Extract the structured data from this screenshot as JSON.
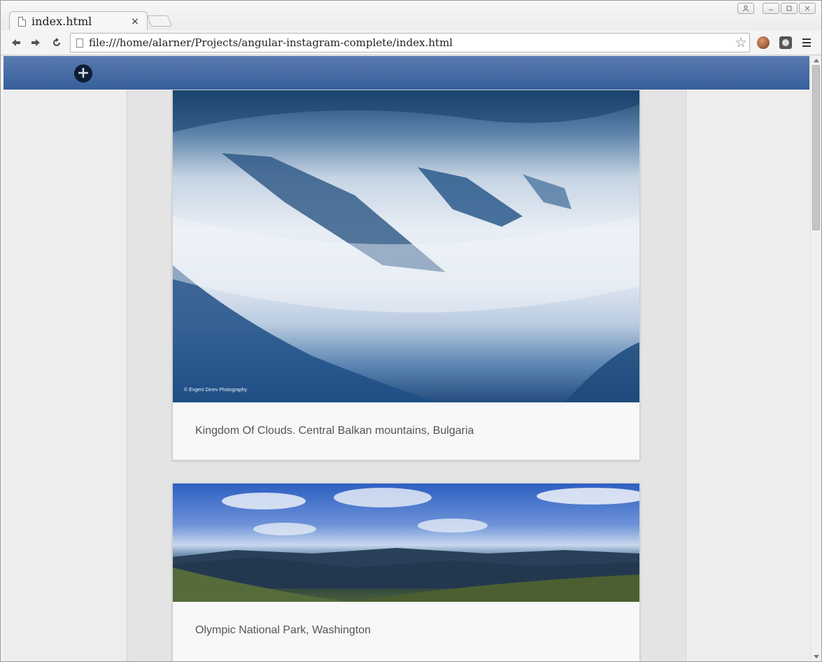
{
  "browser": {
    "tab": {
      "title": "index.html",
      "close_glyph": "×"
    },
    "address_bar": {
      "url": "file:///home/alarner/Projects/angular-instagram-complete/index.html"
    },
    "icons": [
      "page-icon",
      "star-icon",
      "back-icon",
      "forward-icon",
      "reload-icon",
      "menu-icon",
      "user-icon",
      "minimize-icon",
      "maximize-icon",
      "close-icon"
    ]
  },
  "app": {
    "header": {
      "add_glyph": "+"
    },
    "posts": [
      {
        "caption": "Kingdom Of Clouds. Central Balkan mountains, Bulgaria",
        "photo_credit": "© Evgeni Dinev Photography"
      },
      {
        "caption": "Olympic National Park, Washington"
      }
    ]
  },
  "colors": {
    "header_gradient_top": "#5a7ab0",
    "header_gradient_bottom": "#365f9b",
    "add_button": "#0e1d33",
    "caption_text": "#555555"
  }
}
